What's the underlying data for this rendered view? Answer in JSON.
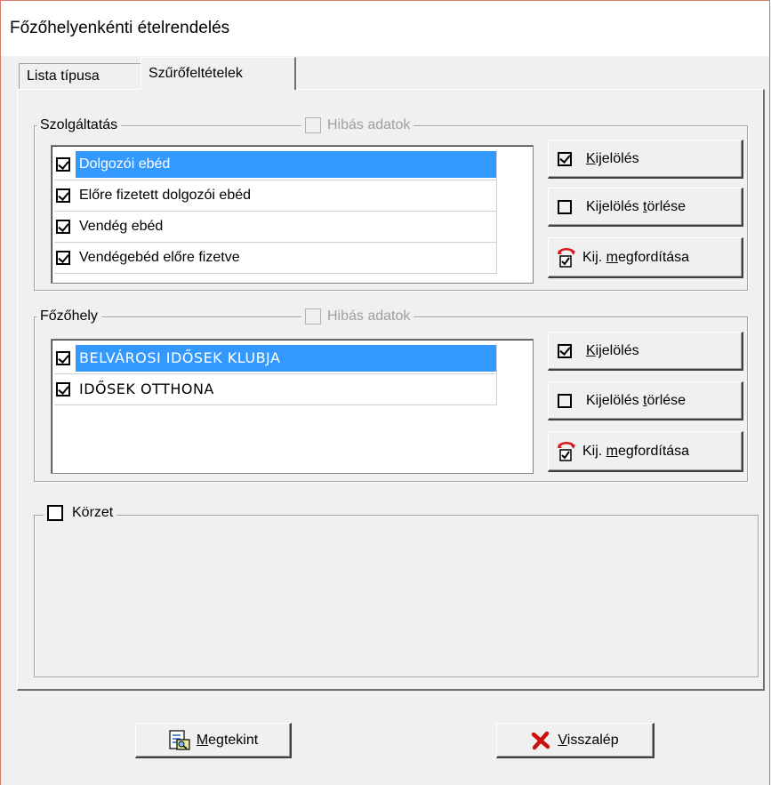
{
  "window": {
    "title": "Főzőhelyenkénti ételrendelés"
  },
  "tabs": [
    {
      "label": "Lista típusa",
      "active": false
    },
    {
      "label": "Szűrőfeltételek",
      "active": true
    }
  ],
  "szolgaltatas": {
    "label": "Szolgáltatás",
    "hibas_label": "Hibás adatok",
    "hibas_checked": false,
    "items": [
      {
        "label": "Dolgozói ebéd",
        "checked": true,
        "selected": true
      },
      {
        "label": "Előre fizetett dolgozói ebéd",
        "checked": true,
        "selected": false
      },
      {
        "label": "Vendég ebéd",
        "checked": true,
        "selected": false
      },
      {
        "label": "Vendégebéd előre fizetve",
        "checked": true,
        "selected": false
      }
    ],
    "buttons": {
      "select_prefix": "K",
      "select_rest": "ijelölés",
      "clear_prefix": "Kijelölés ",
      "clear_u": "t",
      "clear_rest": "örlése",
      "invert_prefix": "Kij. ",
      "invert_u": "m",
      "invert_rest": "egfordítása"
    }
  },
  "fozohely": {
    "label": "Főzőhely",
    "hibas_label": "Hibás adatok",
    "hibas_checked": false,
    "items": [
      {
        "label": "BELVÁROSI IDŐSEK KLUBJA",
        "checked": true,
        "selected": true
      },
      {
        "label": "IDŐSEK OTTHONA",
        "checked": true,
        "selected": false
      }
    ],
    "buttons": {
      "select_prefix": "K",
      "select_rest": "ijelölés",
      "clear_prefix": "Kijelölés ",
      "clear_u": "t",
      "clear_rest": "örlése",
      "invert_prefix": "Kij. ",
      "invert_u": "m",
      "invert_rest": "egfordítása"
    }
  },
  "korzet": {
    "label": "Körzet",
    "checked": false
  },
  "footer": {
    "view_u": "M",
    "view_rest": "egtekint",
    "back_u": "V",
    "back_rest": "isszalép"
  },
  "icons": {
    "view": "preview-document-icon",
    "back": "red-x-icon",
    "invert": "invert-selection-icon"
  },
  "colors": {
    "selection": "#3399ff",
    "back_icon": "#cc1010",
    "invert_icon": "#d81818"
  }
}
